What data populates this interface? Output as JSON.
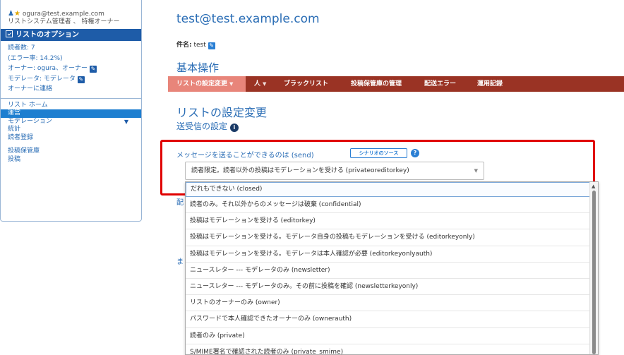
{
  "sidebar": {
    "user_email": "ogura@test.example.com",
    "user_roles": "リストシステム管理者 、 特権オーナー",
    "options_header": "リストのオプション",
    "options": [
      {
        "label": "読者数: 7"
      },
      {
        "label": "(エラー率: 14.2%)"
      },
      {
        "label": "オーナー: ogura、オーナー"
      },
      {
        "label": "モデレータ: モデレータ"
      },
      {
        "label": "オーナーに連絡"
      }
    ],
    "nav": [
      {
        "label": "リスト ホーム"
      },
      {
        "label": "運営"
      },
      {
        "label": "モデレーション"
      },
      {
        "label": "統計"
      },
      {
        "label": "読者登録"
      },
      {
        "label": "投稿保管庫"
      },
      {
        "label": "投稿"
      }
    ]
  },
  "main": {
    "list_address": "test@test.example.com",
    "subject_label": "件名:",
    "subject_value": "test",
    "section_title": "基本操作",
    "menu": [
      {
        "label": "リストの設定変更"
      },
      {
        "label": "人"
      },
      {
        "label": "ブラックリスト"
      },
      {
        "label": "投稿保管庫の管理"
      },
      {
        "label": "配送エラー"
      },
      {
        "label": "運用記録"
      }
    ],
    "page_title": "リストの設定変更",
    "subsection_title": "送受信の設定",
    "send_label": "メッセージを送ることができるのは (send)",
    "scenario_source_button": "シナリオのソース",
    "help_glyph": "?",
    "info_glyph": "i",
    "selected_value": "読者限定。読者以外の投稿はモデレーションを受ける (privateoreditorkey)",
    "bg_fragments": [
      "配",
      "ま"
    ],
    "dropdown_options": [
      "だれもできない (closed)",
      "読者のみ。それ以外からのメッセージは破棄 (confidential)",
      "投稿はモデレーションを受ける (editorkey)",
      "投稿はモデレーションを受ける。モデレータ自身の投稿もモデレーションを受ける (editorkeyonly)",
      "投稿はモデレーションを受ける。モデレータは本人確認が必要 (editorkeyonlyauth)",
      "ニュースレター --- モデレータのみ (newsletter)",
      "ニュースレター --- モデレータのみ。その前に投稿を確認 (newsletterkeyonly)",
      "リストのオーナーのみ (owner)",
      "パスワードで本人確認できたオーナーのみ (ownerauth)",
      "読者のみ (private)",
      "S/MIME署名で確認された読者のみ (private_smime)"
    ]
  },
  "colors": {
    "primary_blue": "#1e5ca8",
    "link_blue": "#2a6db5",
    "menubar": "#9a3324",
    "menu_selected": "#e8857a",
    "highlight_box": "#e00000"
  }
}
